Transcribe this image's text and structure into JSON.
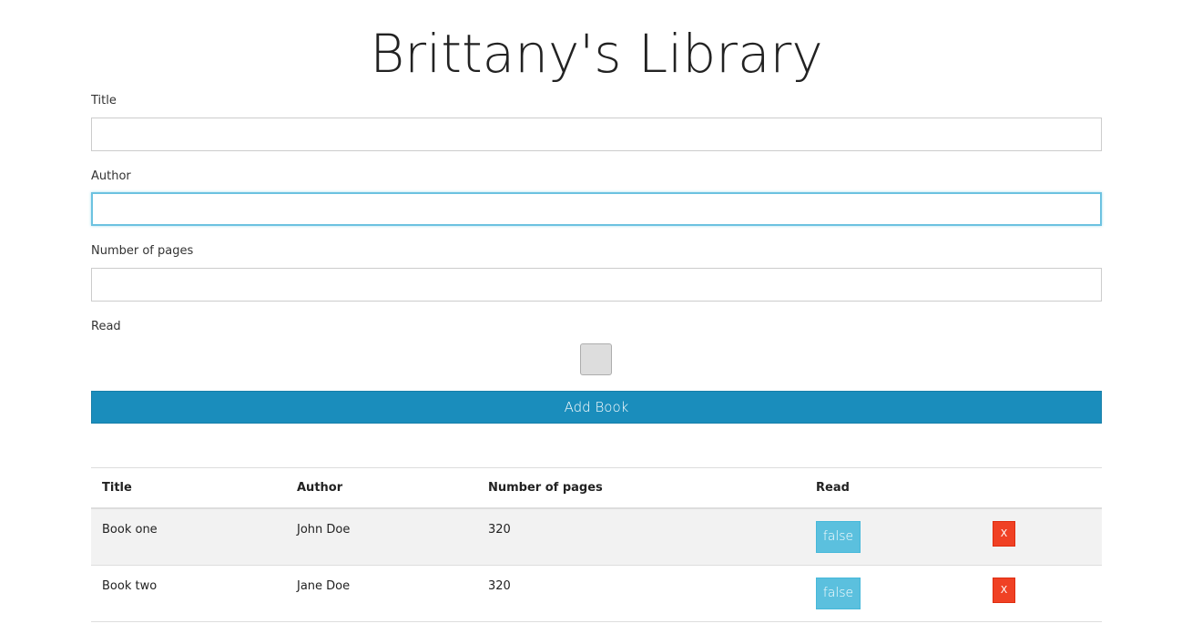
{
  "page": {
    "title": "Brittany's Library"
  },
  "form": {
    "title_label": "Title",
    "title_value": "",
    "author_label": "Author",
    "author_value": "",
    "pages_label": "Number of pages",
    "pages_value": "",
    "read_label": "Read",
    "read_checked": false,
    "submit_label": "Add Book"
  },
  "table": {
    "headers": [
      "Title",
      "Author",
      "Number of pages",
      "Read",
      ""
    ],
    "rows": [
      {
        "title": "Book one",
        "author": "John Doe",
        "pages": "320",
        "read": "false",
        "delete": "X"
      },
      {
        "title": "Book two",
        "author": "Jane Doe",
        "pages": "320",
        "read": "false",
        "delete": "X"
      }
    ]
  },
  "colors": {
    "primary_button": "#1a8dbc",
    "read_button": "#5bc0de",
    "delete_button": "#f04124",
    "focus_border": "#6cc2e0",
    "stripe": "#f2f2f2"
  }
}
